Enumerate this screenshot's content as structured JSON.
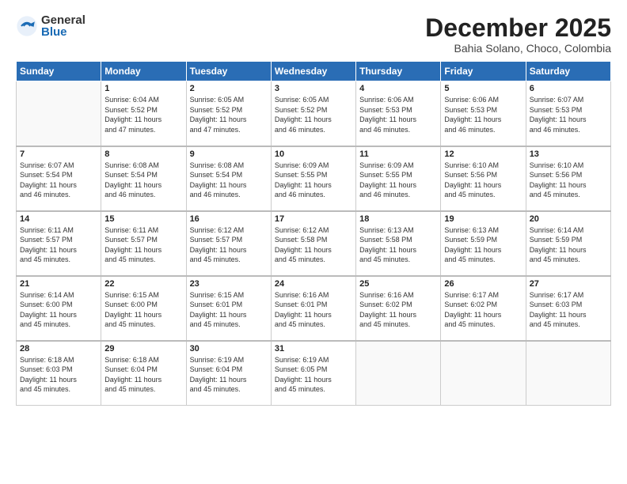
{
  "logo": {
    "general": "General",
    "blue": "Blue"
  },
  "title": "December 2025",
  "location": "Bahia Solano, Choco, Colombia",
  "days_of_week": [
    "Sunday",
    "Monday",
    "Tuesday",
    "Wednesday",
    "Thursday",
    "Friday",
    "Saturday"
  ],
  "weeks": [
    [
      {
        "day": "",
        "info": ""
      },
      {
        "day": "1",
        "info": "Sunrise: 6:04 AM\nSunset: 5:52 PM\nDaylight: 11 hours\nand 47 minutes."
      },
      {
        "day": "2",
        "info": "Sunrise: 6:05 AM\nSunset: 5:52 PM\nDaylight: 11 hours\nand 47 minutes."
      },
      {
        "day": "3",
        "info": "Sunrise: 6:05 AM\nSunset: 5:52 PM\nDaylight: 11 hours\nand 46 minutes."
      },
      {
        "day": "4",
        "info": "Sunrise: 6:06 AM\nSunset: 5:53 PM\nDaylight: 11 hours\nand 46 minutes."
      },
      {
        "day": "5",
        "info": "Sunrise: 6:06 AM\nSunset: 5:53 PM\nDaylight: 11 hours\nand 46 minutes."
      },
      {
        "day": "6",
        "info": "Sunrise: 6:07 AM\nSunset: 5:53 PM\nDaylight: 11 hours\nand 46 minutes."
      }
    ],
    [
      {
        "day": "7",
        "info": "Sunrise: 6:07 AM\nSunset: 5:54 PM\nDaylight: 11 hours\nand 46 minutes."
      },
      {
        "day": "8",
        "info": "Sunrise: 6:08 AM\nSunset: 5:54 PM\nDaylight: 11 hours\nand 46 minutes."
      },
      {
        "day": "9",
        "info": "Sunrise: 6:08 AM\nSunset: 5:54 PM\nDaylight: 11 hours\nand 46 minutes."
      },
      {
        "day": "10",
        "info": "Sunrise: 6:09 AM\nSunset: 5:55 PM\nDaylight: 11 hours\nand 46 minutes."
      },
      {
        "day": "11",
        "info": "Sunrise: 6:09 AM\nSunset: 5:55 PM\nDaylight: 11 hours\nand 46 minutes."
      },
      {
        "day": "12",
        "info": "Sunrise: 6:10 AM\nSunset: 5:56 PM\nDaylight: 11 hours\nand 45 minutes."
      },
      {
        "day": "13",
        "info": "Sunrise: 6:10 AM\nSunset: 5:56 PM\nDaylight: 11 hours\nand 45 minutes."
      }
    ],
    [
      {
        "day": "14",
        "info": "Sunrise: 6:11 AM\nSunset: 5:57 PM\nDaylight: 11 hours\nand 45 minutes."
      },
      {
        "day": "15",
        "info": "Sunrise: 6:11 AM\nSunset: 5:57 PM\nDaylight: 11 hours\nand 45 minutes."
      },
      {
        "day": "16",
        "info": "Sunrise: 6:12 AM\nSunset: 5:57 PM\nDaylight: 11 hours\nand 45 minutes."
      },
      {
        "day": "17",
        "info": "Sunrise: 6:12 AM\nSunset: 5:58 PM\nDaylight: 11 hours\nand 45 minutes."
      },
      {
        "day": "18",
        "info": "Sunrise: 6:13 AM\nSunset: 5:58 PM\nDaylight: 11 hours\nand 45 minutes."
      },
      {
        "day": "19",
        "info": "Sunrise: 6:13 AM\nSunset: 5:59 PM\nDaylight: 11 hours\nand 45 minutes."
      },
      {
        "day": "20",
        "info": "Sunrise: 6:14 AM\nSunset: 5:59 PM\nDaylight: 11 hours\nand 45 minutes."
      }
    ],
    [
      {
        "day": "21",
        "info": "Sunrise: 6:14 AM\nSunset: 6:00 PM\nDaylight: 11 hours\nand 45 minutes."
      },
      {
        "day": "22",
        "info": "Sunrise: 6:15 AM\nSunset: 6:00 PM\nDaylight: 11 hours\nand 45 minutes."
      },
      {
        "day": "23",
        "info": "Sunrise: 6:15 AM\nSunset: 6:01 PM\nDaylight: 11 hours\nand 45 minutes."
      },
      {
        "day": "24",
        "info": "Sunrise: 6:16 AM\nSunset: 6:01 PM\nDaylight: 11 hours\nand 45 minutes."
      },
      {
        "day": "25",
        "info": "Sunrise: 6:16 AM\nSunset: 6:02 PM\nDaylight: 11 hours\nand 45 minutes."
      },
      {
        "day": "26",
        "info": "Sunrise: 6:17 AM\nSunset: 6:02 PM\nDaylight: 11 hours\nand 45 minutes."
      },
      {
        "day": "27",
        "info": "Sunrise: 6:17 AM\nSunset: 6:03 PM\nDaylight: 11 hours\nand 45 minutes."
      }
    ],
    [
      {
        "day": "28",
        "info": "Sunrise: 6:18 AM\nSunset: 6:03 PM\nDaylight: 11 hours\nand 45 minutes."
      },
      {
        "day": "29",
        "info": "Sunrise: 6:18 AM\nSunset: 6:04 PM\nDaylight: 11 hours\nand 45 minutes."
      },
      {
        "day": "30",
        "info": "Sunrise: 6:19 AM\nSunset: 6:04 PM\nDaylight: 11 hours\nand 45 minutes."
      },
      {
        "day": "31",
        "info": "Sunrise: 6:19 AM\nSunset: 6:05 PM\nDaylight: 11 hours\nand 45 minutes."
      },
      {
        "day": "",
        "info": ""
      },
      {
        "day": "",
        "info": ""
      },
      {
        "day": "",
        "info": ""
      }
    ]
  ]
}
